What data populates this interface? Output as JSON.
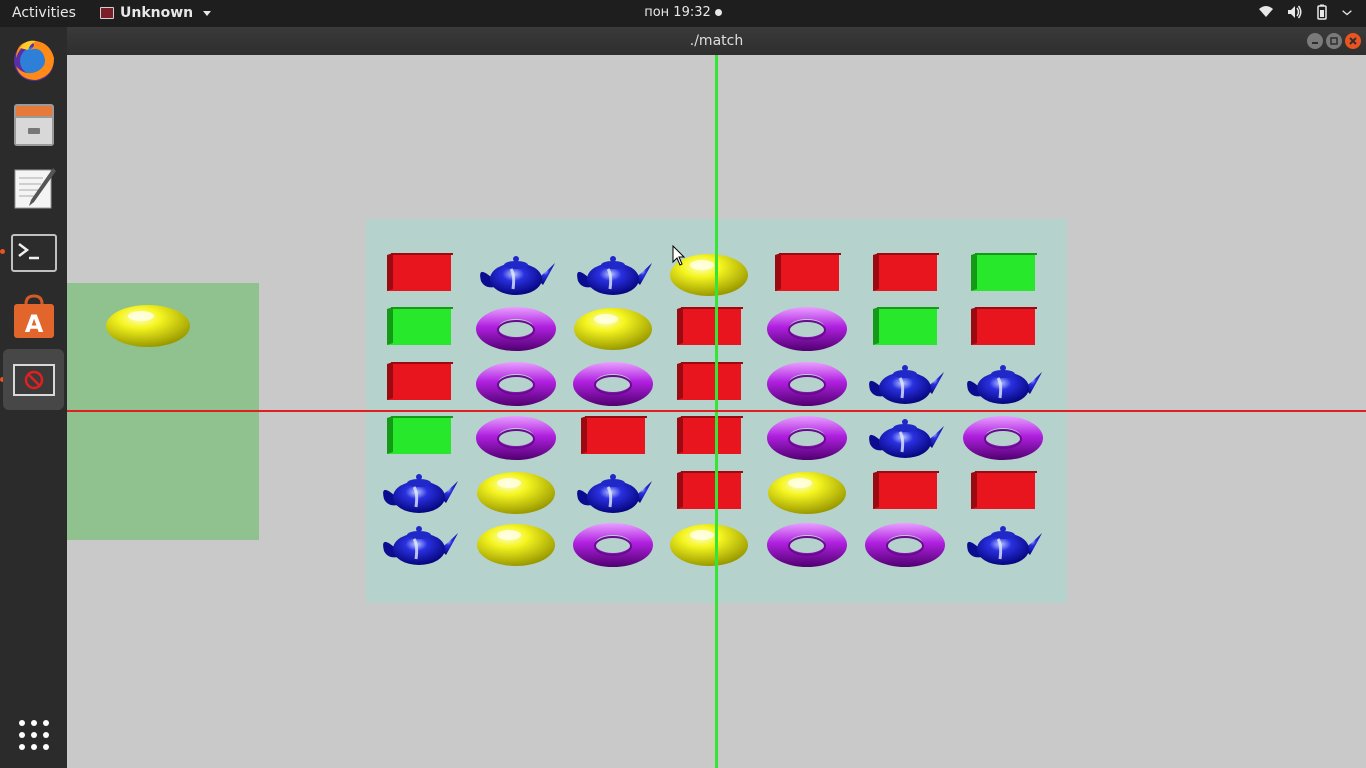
{
  "topbar": {
    "activities": "Activities",
    "app_name": "Unknown",
    "clock": "пон 19:32"
  },
  "dock": {
    "items": [
      {
        "name": "firefox",
        "icon": "firefox-icon"
      },
      {
        "name": "files",
        "icon": "file-cabinet-icon"
      },
      {
        "name": "text-editor",
        "icon": "text-editor-icon"
      },
      {
        "name": "terminal",
        "icon": "terminal-icon"
      },
      {
        "name": "software",
        "icon": "software-store-icon"
      },
      {
        "name": "unknown-app",
        "icon": "unknown-app-icon"
      },
      {
        "name": "show-apps",
        "icon": "app-grid-icon"
      }
    ]
  },
  "window": {
    "title": "./match"
  },
  "game": {
    "next_piece": "ellipsoid",
    "colors": {
      "cube_red": "#e8141e",
      "cube_green": "#27e82a",
      "teapot": "#1010c8",
      "torus": "#a020d0",
      "ellipsoid": "#f0f010"
    },
    "grid": [
      [
        "red-cube",
        "teapot",
        "teapot",
        "ellipsoid",
        "red-cube",
        "red-cube",
        "green-cube"
      ],
      [
        "green-cube",
        "torus",
        "ellipsoid",
        "red-cube",
        "torus",
        "green-cube",
        "red-cube"
      ],
      [
        "red-cube",
        "torus",
        "torus",
        "red-cube",
        "torus",
        "teapot",
        "teapot"
      ],
      [
        "green-cube",
        "torus",
        "red-cube",
        "red-cube",
        "torus",
        "teapot",
        "torus"
      ],
      [
        "teapot",
        "ellipsoid",
        "teapot",
        "red-cube",
        "ellipsoid",
        "red-cube",
        "red-cube"
      ],
      [
        "teapot",
        "ellipsoid",
        "torus",
        "ellipsoid",
        "torus",
        "torus",
        "teapot"
      ]
    ]
  }
}
